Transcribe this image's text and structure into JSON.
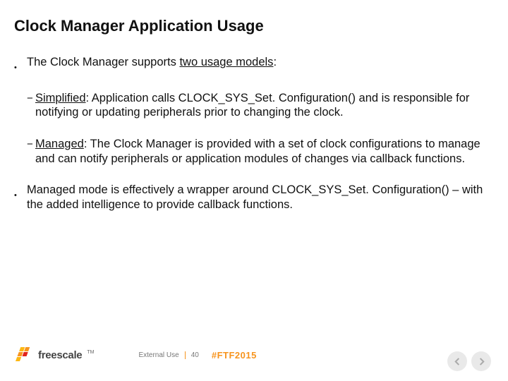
{
  "title": "Clock Manager Application Usage",
  "bullets": {
    "b1_pre": "The Clock Manager supports ",
    "b1_u": "two usage models",
    "b1_post": ":",
    "s1_u": "Simplified",
    "s1_rest": ": Application calls CLOCK_SYS_Set. Configuration() and is responsible for notifying or updating peripherals prior to changing the clock.",
    "s2_u": "Managed",
    "s2_rest": ": The Clock Manager is provided with a set of clock configurations to manage and can notify peripherals or application modules of changes via callback functions.",
    "b2": "Managed mode is effectively a wrapper around CLOCK_SYS_Set. Configuration() – with the added intelligence to provide callback functions."
  },
  "footer": {
    "brand": "freescale",
    "external": "External Use",
    "page": "40",
    "hashtag": "#FTF2015"
  }
}
